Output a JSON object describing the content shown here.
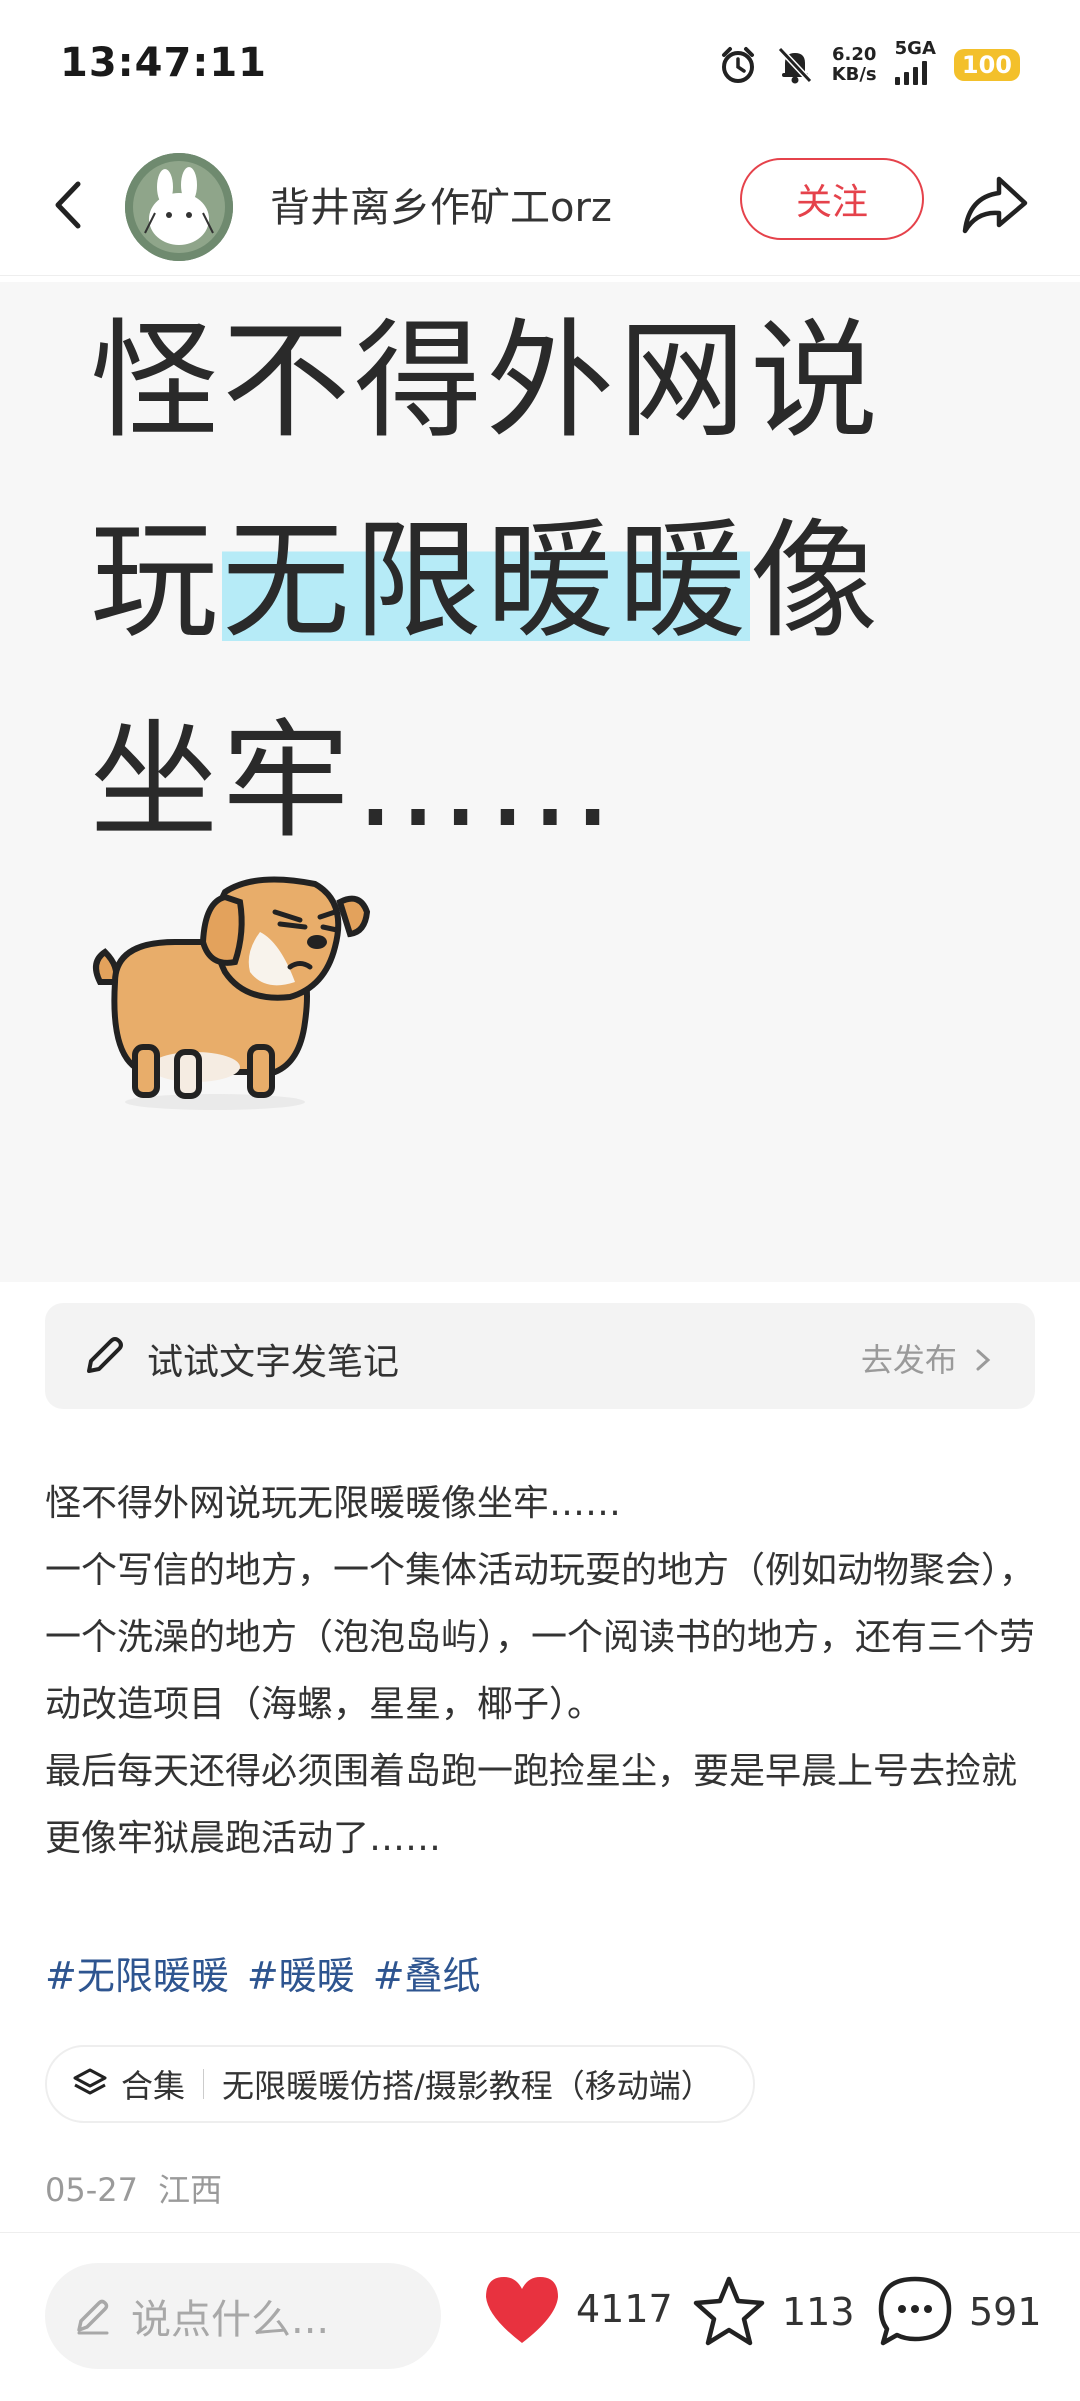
{
  "status_bar": {
    "time": "13:47:11",
    "net_speed_value": "6.20",
    "net_speed_unit": "KB/s",
    "network": "5GA",
    "battery": "100",
    "battery_color": "#f3c02b"
  },
  "header": {
    "author_name": "背井离乡作矿工orz",
    "follow_label": "关注"
  },
  "hero": {
    "line1": "怪不得外网说",
    "line2_pre": "玩",
    "line2_highlight": "无限暖暖",
    "line2_post": "像",
    "line3": "坐牢……"
  },
  "draft": {
    "label": "试试文字发笔记",
    "action": "去发布"
  },
  "post": {
    "paragraphs": [
      "怪不得外网说玩无限暖暖像坐牢……",
      "一个写信的地方，一个集体活动玩耍的地方（例如动物聚会），一个洗澡的地方（泡泡岛屿），一个阅读书的地方，还有三个劳动改造项目（海螺，星星，椰子）。",
      "最后每天还得必须围着岛跑一跑捡星尘，要是早晨上号去捡就更像牢狱晨跑活动了……"
    ],
    "tags": [
      "#无限暖暖",
      "#暖暖",
      "#叠纸"
    ]
  },
  "collection": {
    "label": "合集",
    "title": "无限暖暖仿搭/摄影教程（移动端）"
  },
  "meta": {
    "date": "05-27",
    "location": "江西"
  },
  "bottom_bar": {
    "comment_placeholder": "说点什么...",
    "likes": "4117",
    "stars": "113",
    "comments": "591",
    "like_color": "#e8323f"
  }
}
